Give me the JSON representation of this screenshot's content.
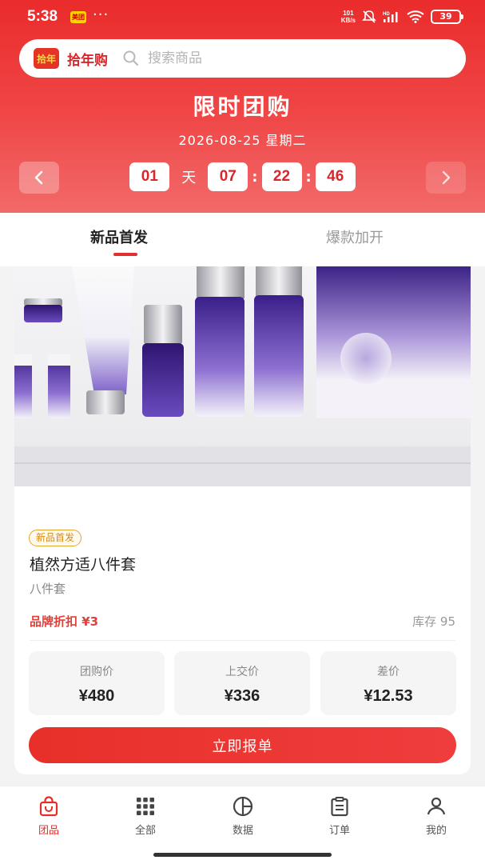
{
  "status_bar": {
    "time": "5:38",
    "app_badge": "美团",
    "dots": "···",
    "net_speed_top": "101",
    "net_speed_bottom": "KB/s",
    "signal_label": "HD",
    "battery": "39"
  },
  "header": {
    "brand_name": "拾年购",
    "logo_text": "拾年",
    "search_placeholder": "搜索商品",
    "title": "限时团购",
    "date": "2026-08-25 星期二",
    "countdown": {
      "days": "01",
      "day_unit": "天",
      "hours": "07",
      "minutes": "22",
      "seconds": "46",
      "separator": ":"
    }
  },
  "tabs": [
    {
      "label": "新品首发",
      "active": true
    },
    {
      "label": "爆款加开",
      "active": false
    }
  ],
  "product": {
    "image_icon": "skincare-products-image",
    "badge": "新品首发",
    "name": "植然方适八件套",
    "subtitle": "八件套",
    "discount": "品牌折扣 ¥3",
    "stock": "库存 95",
    "prices": [
      {
        "label": "团购价",
        "value": "¥480"
      },
      {
        "label": "上交价",
        "value": "¥336"
      },
      {
        "label": "差价",
        "value": "¥12.53"
      }
    ],
    "cta": "立即报单"
  },
  "bottom_nav": [
    {
      "label": "团品",
      "icon": "bag-icon",
      "active": true
    },
    {
      "label": "全部",
      "icon": "grid-icon",
      "active": false
    },
    {
      "label": "数据",
      "icon": "chart-pie-icon",
      "active": false
    },
    {
      "label": "订单",
      "icon": "clipboard-icon",
      "active": false
    },
    {
      "label": "我的",
      "icon": "user-icon",
      "active": false
    }
  ],
  "colors": {
    "brand_red": "#e8302a",
    "badge_gold": "#e3a52a",
    "page_bg": "#f3f3f3"
  }
}
